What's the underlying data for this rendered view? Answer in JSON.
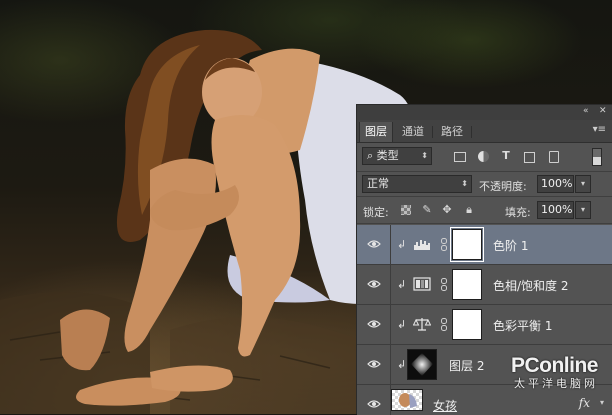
{
  "tabs": [
    {
      "label": "图层",
      "active": true
    },
    {
      "label": "通道",
      "active": false
    },
    {
      "label": "路径",
      "active": false
    }
  ],
  "filter": {
    "kind_label": "⌕ 类型",
    "icons": [
      "image-filter-icon",
      "adjustment-filter-icon",
      "type-filter-icon",
      "shape-filter-icon",
      "smart-object-filter-icon"
    ],
    "type_glyph": "T"
  },
  "blend": {
    "mode": "正常",
    "opacity_label": "不透明度:",
    "opacity_value": "100%"
  },
  "lock": {
    "label": "锁定:",
    "fill_label": "填充:",
    "fill_value": "100%"
  },
  "layers": [
    {
      "name": "色阶 1",
      "type": "adjustment",
      "icon": "levels-icon",
      "selected": true
    },
    {
      "name": "色相/饱和度 2",
      "type": "adjustment",
      "icon": "hue-saturation-icon",
      "selected": false
    },
    {
      "name": "色彩平衡 1",
      "type": "adjustment",
      "icon": "color-balance-icon",
      "selected": false
    },
    {
      "name": "图层 2",
      "type": "pixel",
      "icon": "layer-thumbnail",
      "selected": false
    },
    {
      "name": "女孩",
      "type": "pixel",
      "icon": "photo-thumbnail",
      "selected": false,
      "fx": "fx"
    }
  ],
  "watermark": {
    "logo": "PConline",
    "sub": "太平洋电脑网"
  },
  "colors": {
    "panel_bg": "#535353",
    "selected_row": "#6d7787",
    "tab_bar": "#424242"
  }
}
